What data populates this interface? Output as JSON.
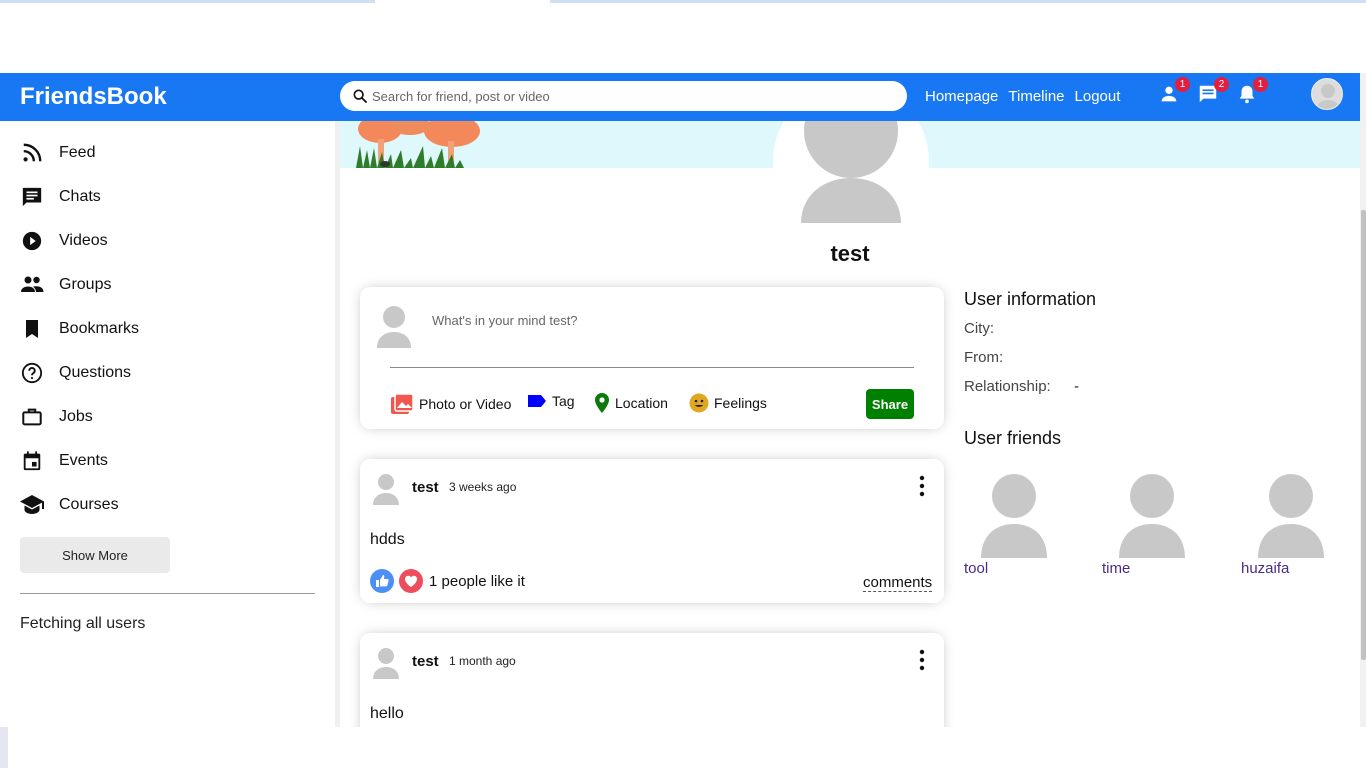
{
  "app": {
    "title": "FriendsBook"
  },
  "search": {
    "placeholder": "Search for friend, post or video"
  },
  "nav": {
    "links": [
      "Homepage",
      "Timeline",
      "Logout"
    ],
    "badges": {
      "friends": "1",
      "messages": "2",
      "notifications": "1"
    }
  },
  "sidebar": {
    "items": [
      {
        "label": "Feed",
        "icon": "rss-feed-icon"
      },
      {
        "label": "Chats",
        "icon": "chat-icon"
      },
      {
        "label": "Videos",
        "icon": "play-circle-icon"
      },
      {
        "label": "Groups",
        "icon": "group-icon"
      },
      {
        "label": "Bookmarks",
        "icon": "bookmark-icon"
      },
      {
        "label": "Questions",
        "icon": "help-outline-icon"
      },
      {
        "label": "Jobs",
        "icon": "work-outline-icon"
      },
      {
        "label": "Events",
        "icon": "event-icon"
      },
      {
        "label": "Courses",
        "icon": "school-icon"
      }
    ],
    "show_more": "Show More",
    "status": "Fetching all users"
  },
  "profile": {
    "username": "test"
  },
  "share": {
    "placeholder": "What's in your mind test?",
    "options": {
      "photo": "Photo or Video",
      "tag": "Tag",
      "location": "Location",
      "feelings": "Feelings"
    },
    "button": "Share"
  },
  "posts": [
    {
      "author": "test",
      "date": "3 weeks ago",
      "text": "hdds",
      "likes": "1 people like it",
      "comments": "comments"
    },
    {
      "author": "test",
      "date": "1 month ago",
      "text": "hello"
    }
  ],
  "user_info": {
    "title": "User information",
    "city_label": "City:",
    "city_value": "",
    "from_label": "From:",
    "from_value": "",
    "relationship_label": "Relationship:",
    "relationship_value": "-"
  },
  "friends": {
    "title": "User friends",
    "list": [
      "tool",
      "time",
      "huzaifa"
    ]
  },
  "colors": {
    "navbar": "#1877f2",
    "share_button": "#008000",
    "badge": "#e41e3f",
    "friend_name": "#4a2b8a"
  }
}
